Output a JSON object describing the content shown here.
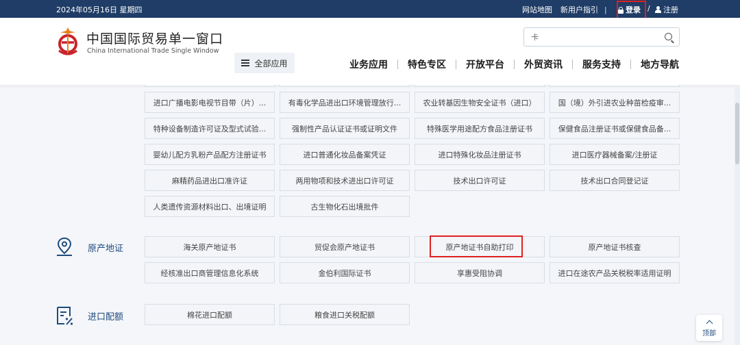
{
  "topbar": {
    "date": "2024年05月16日 星期四",
    "site_map": "网站地图",
    "new_user_guide": "新用户指引",
    "divider": "|",
    "login": "登录",
    "slash": "/",
    "register": "注册"
  },
  "header": {
    "brand_cn": "中国国际贸易单一窗口",
    "brand_en": "China International Trade Single Window",
    "all_apps": "全部应用",
    "search_value": "卡",
    "nav": [
      "业务应用",
      "特色专区",
      "开放平台",
      "外贸资讯",
      "服务支持",
      "地方导航"
    ]
  },
  "grid": {
    "rows": [
      [
        "进口广播电影电视节目带（片）...",
        "有毒化学品进出口环境管理放行...",
        "农业转基因生物安全证书（进口）",
        "国（境）外引进农业种苗检疫审..."
      ],
      [
        "特种设备制造许可证及型式试验...",
        "强制性产品认证证书或证明文件",
        "特殊医学用途配方食品注册证书",
        "保健食品注册证书或保健食品备..."
      ],
      [
        "婴幼儿配方乳粉产品配方注册证书",
        "进口普通化妆品备案凭证",
        "进口特殊化妆品注册证书",
        "进口医疗器械备案/注册证"
      ],
      [
        "麻精药品进出口准许证",
        "两用物项和技术进出口许可证",
        "技术出口许可证",
        "技术出口合同登记证"
      ],
      [
        "人类遗传资源材料出口、出境证明",
        "古生物化石出境批件"
      ]
    ]
  },
  "origin": {
    "label": "原产地证",
    "rows": [
      [
        "海关原产地证书",
        "贸促会原产地证书",
        "原产地证书自助打印",
        "原产地证书核查"
      ],
      [
        "经核准出口商管理信息化系统",
        "金伯利国际证书",
        "享惠受阻协调",
        "进口在途农产品关税税率适用证明"
      ]
    ]
  },
  "quota": {
    "label": "进口配额",
    "rows": [
      [
        "棉花进口配额",
        "粮食进口关税配额"
      ]
    ]
  },
  "to_top": "顶部",
  "colors": {
    "topbar": "#1f3d66",
    "accent": "#1f4a7d",
    "highlight": "#e02020",
    "logo_orange": "#e8811a",
    "logo_red": "#c8242b"
  }
}
